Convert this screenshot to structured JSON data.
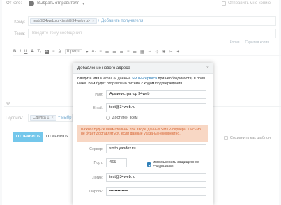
{
  "compose": {
    "from_label": "От кого:",
    "from_select": "Выбрать отправителя",
    "copy_me_label": "Отправить мне копию",
    "to_label": "Кому:",
    "to_chip": "test@34web.ru <test@34web.ru>",
    "add_recipient": "+ Добавить получателя",
    "subject_label": "Тема:",
    "subject_placeholder": "Введите тему сообщения",
    "copy_link": "Копия",
    "bcc_link": "Скрытая копия",
    "toolbar": [
      "B",
      "I",
      "U",
      "S",
      "Tₓ",
      "A",
      "≡",
      "A̲",
      "Шрифт",
      "▾",
      "A·",
      "≡",
      "☰",
      "☰",
      "☰",
      "≡",
      "☰",
      "▦",
      "⇔",
      "⊹",
      "✱",
      "✂",
      "✦"
    ],
    "signature_label": "Подпись:",
    "signature_chip": "Сделка 1",
    "signature_add": "+ выбр",
    "send_button": "ОТПРАВИТЬ",
    "cancel_button": "ОТМЕНИТЬ",
    "save_template_label": "Сохранить как шаблон"
  },
  "modal": {
    "title": "Добавление нового адреса",
    "intro_part1": "Введите имя и email (и данные ",
    "intro_link": "SMTP-сервиса",
    "intro_part2": " при необходимости) в поля ниже. Вам будет отправлено письмо с кодом подтверждения.",
    "name_label": "Имя:",
    "name_value": "Администратор 34web",
    "email_label": "Email:",
    "email_value": "test@34web.ru",
    "available_all_label": "Доступен всем",
    "warning_text": "Важно! Будьте внимательны при вводе данных SMTP-сервера. Письмо не будет доставляться, если данные указаны некорректно.",
    "server_label": "Сервер:",
    "server_value": "smtp.yandex.ru",
    "port_label": "Порт:",
    "port_value": "465",
    "ssl_label": "использовать защищенное соединение",
    "login_label": "Логин:",
    "login_value": "test@34web.ru",
    "password_label": "Пароль:",
    "password_value": "••••••••••••••"
  }
}
